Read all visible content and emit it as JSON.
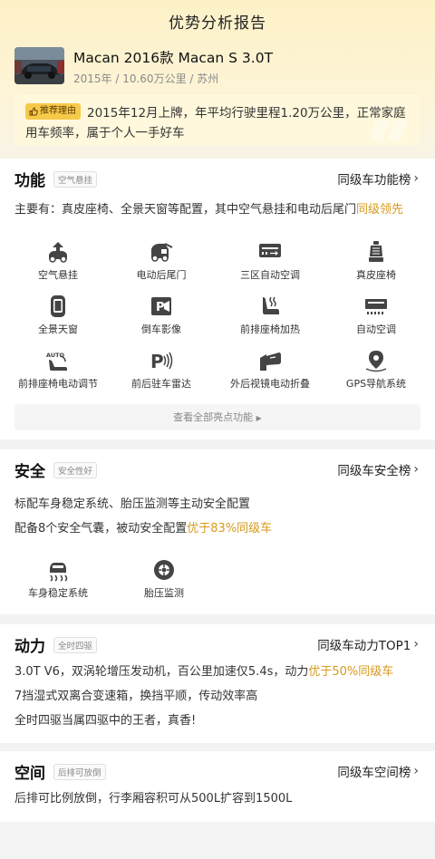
{
  "page": {
    "title": "优势分析报告"
  },
  "car": {
    "name": "Macan 2016款 Macan S 3.0T",
    "meta": "2015年 / 10.60万公里 / 苏州"
  },
  "reason": {
    "tag": "推荐理由",
    "text": "2015年12月上牌，年平均行驶里程1.20万公里，正常家庭用车频率，属于个人一手好车"
  },
  "function_section": {
    "title": "功能",
    "badge": "空气悬挂",
    "rank": "同级车功能榜",
    "desc_plain": "主要有：真皮座椅、全景天窗等配置，其中空气悬挂和电动后尾门",
    "desc_highlight": "同级领先",
    "features": [
      {
        "label": "空气悬挂",
        "icon": "air-suspension-icon"
      },
      {
        "label": "电动后尾门",
        "icon": "power-tailgate-icon"
      },
      {
        "label": "三区自动空调",
        "icon": "tri-zone-ac-icon"
      },
      {
        "label": "真皮座椅",
        "icon": "leather-seat-icon"
      },
      {
        "label": "全景天窗",
        "icon": "panoramic-sunroof-icon"
      },
      {
        "label": "倒车影像",
        "icon": "reverse-camera-icon"
      },
      {
        "label": "前排座椅加热",
        "icon": "seat-heating-icon"
      },
      {
        "label": "自动空调",
        "icon": "auto-ac-icon"
      },
      {
        "label": "前排座椅电动调节",
        "icon": "power-seat-icon"
      },
      {
        "label": "前后驻车雷达",
        "icon": "parking-radar-icon"
      },
      {
        "label": "外后视镜电动折叠",
        "icon": "mirror-fold-icon"
      },
      {
        "label": "GPS导航系统",
        "icon": "gps-nav-icon"
      }
    ],
    "see_all": "查看全部亮点功能"
  },
  "safety_section": {
    "title": "安全",
    "badge": "安全性好",
    "rank": "同级车安全榜",
    "line1": "标配车身稳定系统、胎压监测等主动安全配置",
    "line2_plain": "配备8个安全气囊，被动安全配置",
    "line2_highlight": "优于83%同级车",
    "features": [
      {
        "label": "车身稳定系统",
        "icon": "stability-control-icon"
      },
      {
        "label": "胎压监测",
        "icon": "tire-pressure-icon"
      }
    ]
  },
  "power_section": {
    "title": "动力",
    "badge": "全时四驱",
    "rank": "同级车动力TOP1",
    "line1_plain": "3.0T V6，双涡轮增压发动机，百公里加速仅5.4s，动力",
    "line1_highlight": "优于50%同级车",
    "line2": "7挡湿式双离合变速箱，换挡平顺，传动效率高",
    "line3": "全时四驱当属四驱中的王者，真香!"
  },
  "space_section": {
    "title": "空间",
    "badge": "后排可放倒",
    "rank": "同级车空间榜",
    "line1": "后排可比例放倒，行李厢容积可从500L扩容到1500L"
  },
  "colors": {
    "accent": "#d79a1d",
    "tag_bg": "#f7c94a"
  }
}
